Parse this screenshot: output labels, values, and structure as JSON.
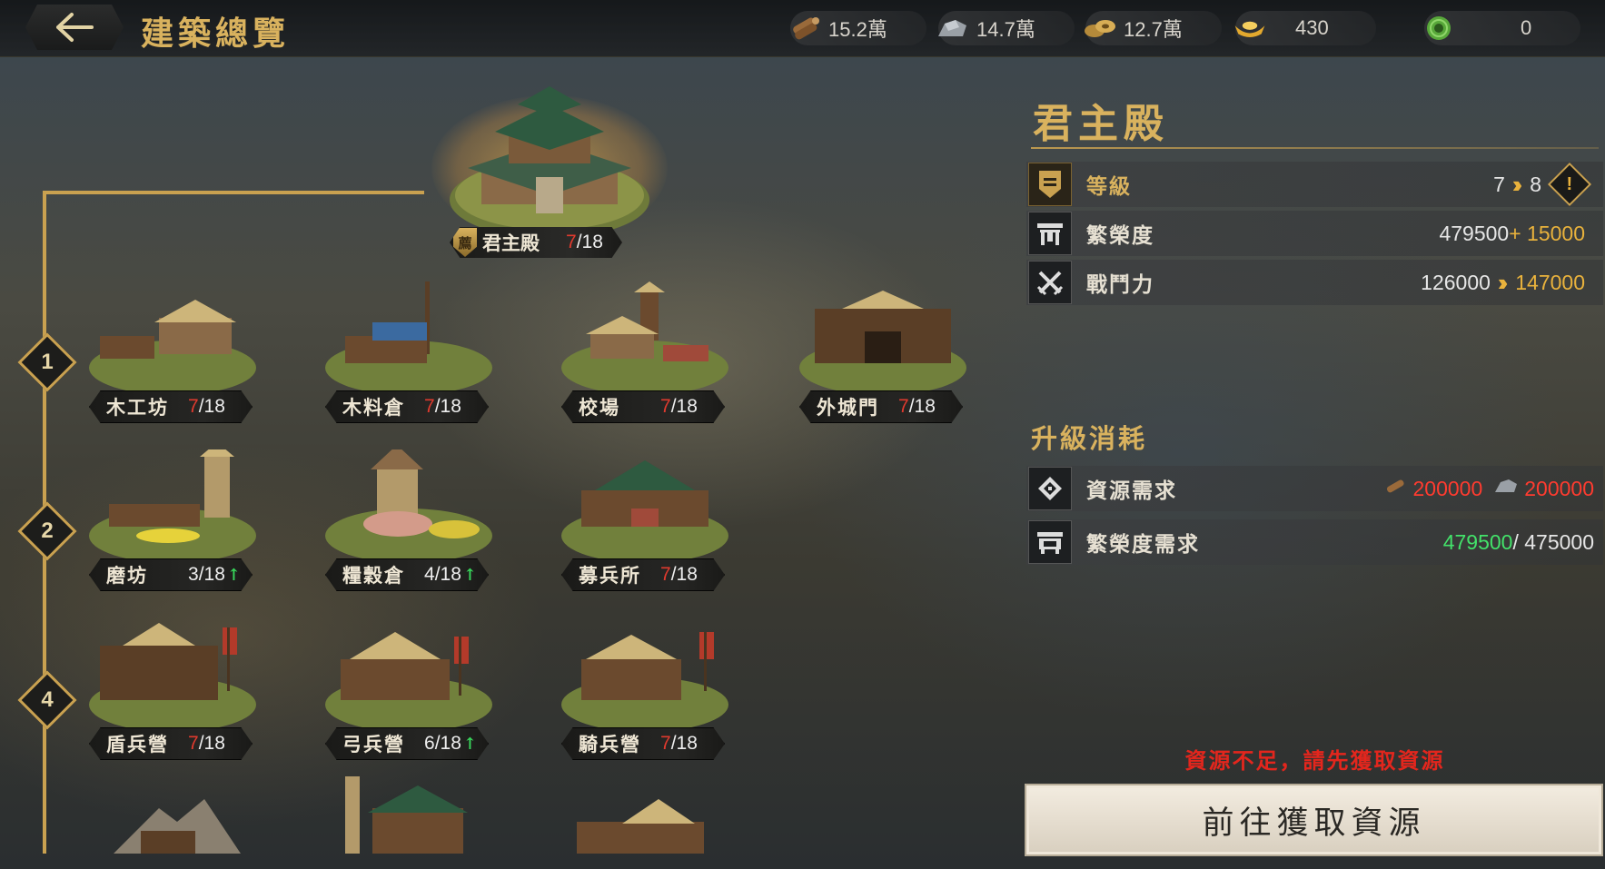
{
  "header": {
    "title": "建築總覽",
    "resources": [
      {
        "icon": "wood-icon",
        "value": "15.2萬"
      },
      {
        "icon": "stone-icon",
        "value": "14.7萬"
      },
      {
        "icon": "coin-icon",
        "value": "12.7萬"
      },
      {
        "icon": "gold-ingot-icon",
        "value": "430"
      },
      {
        "icon": "jade-icon",
        "value": "0"
      }
    ]
  },
  "tree": {
    "tiers": [
      "1",
      "2",
      "4"
    ]
  },
  "main_building": {
    "shield": "薦",
    "name": "君主殿",
    "cur": "7",
    "max": "/18"
  },
  "buildings": [
    {
      "name": "木工坊",
      "cur": "7",
      "max": "/18"
    },
    {
      "name": "木料倉",
      "cur": "7",
      "max": "/18"
    },
    {
      "name": "校場",
      "cur": "7",
      "max": "/18"
    },
    {
      "name": "外城門",
      "cur": "7",
      "max": "/18"
    },
    {
      "name": "磨坊",
      "cur": "3",
      "max": "/18",
      "up": "↑"
    },
    {
      "name": "糧穀倉",
      "cur": "4",
      "max": "/18",
      "up": "↑"
    },
    {
      "name": "募兵所",
      "cur": "7",
      "max": "/18"
    },
    {
      "name": "盾兵營",
      "cur": "7",
      "max": "/18"
    },
    {
      "name": "弓兵營",
      "cur": "6",
      "max": "/18",
      "up": "↑"
    },
    {
      "name": "騎兵營",
      "cur": "7",
      "max": "/18"
    }
  ],
  "panel": {
    "title": "君主殿",
    "stats": {
      "level": {
        "label": "等級",
        "from": "7",
        "to": "8",
        "alert": "!"
      },
      "prosperity": {
        "label": "繁榮度",
        "base": "479500",
        "bonus": "+ 15000"
      },
      "power": {
        "label": "戰鬥力",
        "from": "126000",
        "to": "147000"
      }
    },
    "upgrade_title": "升級消耗",
    "costs": {
      "resources": {
        "label": "資源需求",
        "wood": "200000",
        "stone": "200000"
      },
      "prosperity": {
        "label": "繁榮度需求",
        "have": "479500",
        "need": "/ 475000"
      }
    },
    "warning": "資源不足，請先獲取資源",
    "cta": "前往獲取資源"
  },
  "colors": {
    "gold": "#d9b25e",
    "red": "#e03a2e",
    "green": "#43e26a"
  }
}
